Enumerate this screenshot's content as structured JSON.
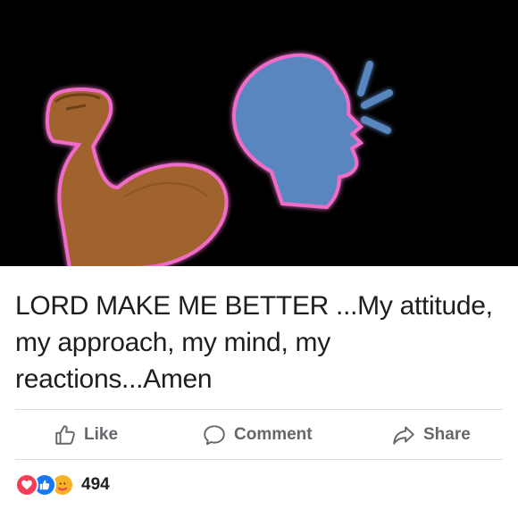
{
  "post": {
    "caption": "LORD MAKE ME BETTER ...My attitude, my approach, my mind, my reactions...Amen",
    "media_icons": [
      "flexed-biceps-emoji",
      "speaking-head-emoji"
    ]
  },
  "actions": {
    "like_label": "Like",
    "comment_label": "Comment",
    "share_label": "Share"
  },
  "reactions": {
    "types": [
      "love",
      "like",
      "care"
    ],
    "count": "494"
  },
  "colors": {
    "media_background": "#000000",
    "action_text": "#65676b",
    "like_blue": "#1877f2",
    "love_red": "#f33e58",
    "care_yellow": "#f7b125"
  }
}
